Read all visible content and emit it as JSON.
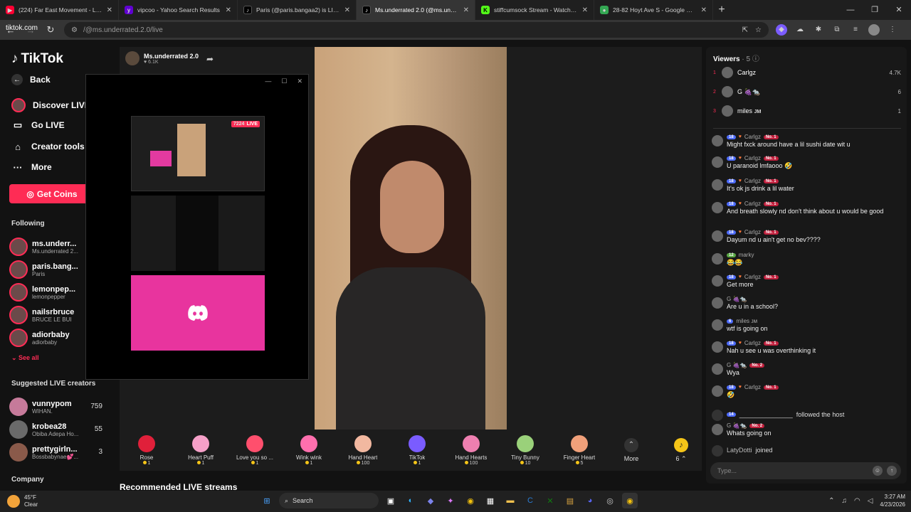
{
  "browser": {
    "tabs": [
      {
        "title": "(224) Far East Movement - Like",
        "icon": "youtube-icon",
        "color": "#ff0033"
      },
      {
        "title": "vipcoo - Yahoo Search Results",
        "icon": "yahoo-icon",
        "color": "#6001d2"
      },
      {
        "title": "Paris (@paris.bangaa2) is LIVE",
        "icon": "tiktok-icon",
        "color": "#000000"
      },
      {
        "title": "Ms.underrated 2.0 (@ms.underrated",
        "icon": "tiktok-icon",
        "color": "#000000"
      },
      {
        "title": "stiffcumsock Stream - Watch Live",
        "icon": "kick-icon",
        "color": "#53fc18"
      },
      {
        "title": "28-82 Hoyt Ave S - Google Maps",
        "icon": "maps-icon",
        "color": "#34a853"
      }
    ],
    "url_host": "tiktok.com",
    "url_path": "/@ms.underrated.2.0/live"
  },
  "sidebar": {
    "logo": "TikTok",
    "nav": [
      {
        "label": "Back",
        "icon": "back-arrow-icon"
      },
      {
        "label": "Discover LIVE",
        "icon": "avatar"
      },
      {
        "label": "Go LIVE",
        "icon": "camera-icon"
      },
      {
        "label": "Creator tools",
        "icon": "lightbulb-icon"
      },
      {
        "label": "More",
        "icon": "ellipsis-icon"
      }
    ],
    "get_coins": "Get Coins",
    "following_header": "Following",
    "following": [
      {
        "name": "ms.underr...",
        "sub": "Ms.underrated 2..."
      },
      {
        "name": "paris.bang...",
        "sub": "Paris"
      },
      {
        "name": "lemonpep...",
        "sub": "lemonpepper"
      },
      {
        "name": "nailsrbruce",
        "sub": "BRUCE LE BUI"
      },
      {
        "name": "adiorbaby",
        "sub": "adiorbaby"
      }
    ],
    "see_all": "See all",
    "suggested_header": "Suggested LIVE creators",
    "suggested": [
      {
        "name": "vunnypom",
        "sub": "WIHAN.",
        "count": "759"
      },
      {
        "name": "krobea28",
        "sub": "Obiba Adepa Ho...",
        "count": "55"
      },
      {
        "name": "prettygirln...",
        "sub": "Bossbabynae💕...",
        "count": "3"
      }
    ],
    "company": "Company"
  },
  "stream": {
    "host_name": "Ms.underrated 2.0",
    "host_likes": "6.1K",
    "mini_live_tag": "LIVE",
    "mini_viewers": "7224"
  },
  "gifts": [
    {
      "name": "Rose",
      "price": "1",
      "color": "#e0203a"
    },
    {
      "name": "Heart Puff",
      "price": "1",
      "color": "#f5a0c8"
    },
    {
      "name": "Love you so ...",
      "price": "1",
      "color": "#ff4f6d"
    },
    {
      "name": "Wink wink",
      "price": "1",
      "color": "#ff6fae"
    },
    {
      "name": "Hand Heart",
      "price": "100",
      "color": "#f2b8a0"
    },
    {
      "name": "TikTok",
      "price": "1",
      "color": "#7a5cff"
    },
    {
      "name": "Hand Hearts",
      "price": "100",
      "color": "#ee7fb0"
    },
    {
      "name": "Tiny Bunny",
      "price": "10",
      "color": "#9ad17a"
    },
    {
      "name": "Finger Heart",
      "price": "5",
      "color": "#f0a07a"
    }
  ],
  "gift_more": "More",
  "coins_count": "6",
  "recommended": "Recommended LIVE streams",
  "viewers": {
    "header": "Viewers",
    "count": "· 5",
    "top": [
      {
        "rank": "1",
        "name": "Carlgz",
        "value": "4.7K"
      },
      {
        "rank": "2",
        "name": "G 🍇🐀",
        "value": "6"
      },
      {
        "rank": "3",
        "name": "miles ᴊᴍ",
        "value": "1"
      }
    ]
  },
  "chat": [
    {
      "user": "Carlgz",
      "level": "18",
      "rank": "No. 1",
      "text": "Might fxck around have a lil sushi date wit u"
    },
    {
      "user": "Carlgz",
      "level": "18",
      "rank": "No. 1",
      "text": "U paranoid lmfaooo 🤣"
    },
    {
      "user": "Carlgz",
      "level": "18",
      "rank": "No. 1",
      "text": "It's ok js drink a lil water"
    },
    {
      "user": "Carlgz",
      "level": "18",
      "rank": "No. 1",
      "text": "And breath slowly nd don't think about u would be good"
    },
    {
      "user": "Carlgz",
      "level": "18",
      "rank": "No. 1",
      "text": "Dayum nd u ain't get no bev????"
    },
    {
      "user": "marky",
      "level": "12",
      "rank": "",
      "text": "😂😂"
    },
    {
      "user": "Carlgz",
      "level": "18",
      "rank": "No. 1",
      "text": "Get more"
    },
    {
      "user": "G 🍇🐀",
      "level": "",
      "rank": "",
      "text": "Are u in a school?"
    },
    {
      "user": "miles ᴊᴍ",
      "level": "6",
      "rank": "",
      "text": "wtf is going on"
    },
    {
      "user": "Carlgz",
      "level": "18",
      "rank": "No. 1",
      "text": "Nah u see u was overthinking it"
    },
    {
      "user": "G 🍇🐀",
      "level": "",
      "rank": "No. 2",
      "text": "Wya"
    },
    {
      "user": "Carlgz",
      "level": "18",
      "rank": "No. 1",
      "text": "🤣"
    }
  ],
  "follow_notice": {
    "level": "14",
    "user": "_______________",
    "text": "followed the host"
  },
  "chat_last": {
    "user": "G 🍇🐀",
    "rank": "No. 2",
    "text": "Whats going on"
  },
  "join_notice": {
    "user": "LatyDotti",
    "text": "joined"
  },
  "chat_placeholder": "Type...",
  "taskbar": {
    "weather_temp": "45°F",
    "weather_desc": "Clear",
    "search": "Search",
    "time": "3:27 AM",
    "date": "4/23/2026"
  }
}
